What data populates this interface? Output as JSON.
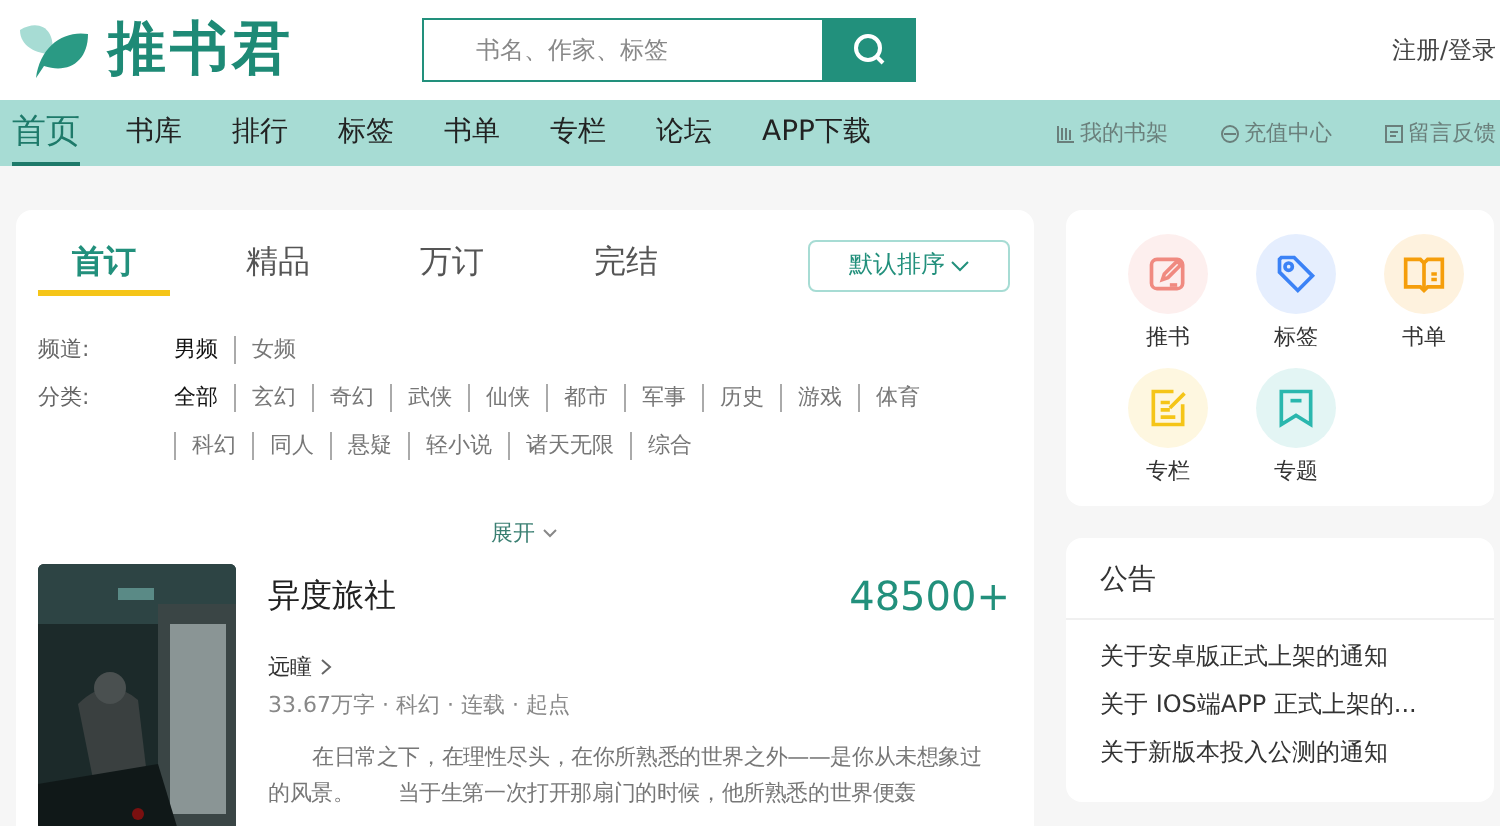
{
  "header": {
    "logo": "推书君",
    "search": {
      "placeholder": "书名、作家、标签"
    },
    "account": "注册/登录"
  },
  "nav": {
    "items": [
      {
        "label": "首页",
        "selected": true
      },
      {
        "label": "书库",
        "selected": false
      },
      {
        "label": "排行",
        "selected": false
      },
      {
        "label": "标签",
        "selected": false
      },
      {
        "label": "书单",
        "selected": false
      },
      {
        "label": "专栏",
        "selected": false
      },
      {
        "label": "论坛",
        "selected": false
      },
      {
        "label": "APP下载",
        "selected": false
      }
    ],
    "links": [
      {
        "label": "我的书架",
        "kind": "shelf"
      },
      {
        "label": "充值中心",
        "kind": "coin"
      },
      {
        "label": "留言反馈",
        "kind": "feedback"
      }
    ]
  },
  "main": {
    "tabs": [
      {
        "label": "首订",
        "selected": true
      },
      {
        "label": "精品",
        "selected": false
      },
      {
        "label": "万订",
        "selected": false
      },
      {
        "label": "完结",
        "selected": false
      }
    ],
    "sort": "默认排序",
    "filters": [
      {
        "label": "频道:",
        "options": [
          {
            "label": "男频",
            "selected": true
          },
          {
            "label": "女频",
            "selected": false
          }
        ]
      },
      {
        "label": "分类:",
        "options": [
          {
            "label": "全部",
            "selected": true
          },
          {
            "label": "玄幻",
            "selected": false
          },
          {
            "label": "奇幻",
            "selected": false
          },
          {
            "label": "武侠",
            "selected": false
          },
          {
            "label": "仙侠",
            "selected": false
          },
          {
            "label": "都市",
            "selected": false
          },
          {
            "label": "军事",
            "selected": false
          },
          {
            "label": "历史",
            "selected": false
          },
          {
            "label": "游戏",
            "selected": false
          },
          {
            "label": "体育",
            "selected": false
          },
          {
            "label": "科幻",
            "selected": false
          },
          {
            "label": "同人",
            "selected": false
          },
          {
            "label": "悬疑",
            "selected": false
          },
          {
            "label": "轻小说",
            "selected": false
          },
          {
            "label": "诸天无限",
            "selected": false
          },
          {
            "label": "综合",
            "selected": false
          }
        ]
      }
    ],
    "expand": "展开",
    "books": [
      {
        "title": "异度旅社",
        "count": "48500+",
        "author": "远瞳",
        "meta": "33.67万字  ·  科幻  ·  连载  ·  起点",
        "description": "在日常之下，在理性尽头，在你所熟悉的世界之外——是你从未想象过的风景。　　当于生第一次打开那扇门的时候，他所熟悉的世界便轰"
      }
    ]
  },
  "shortcuts": [
    {
      "label": "推书",
      "kind": "pen",
      "color": "#f08a80"
    },
    {
      "label": "标签",
      "kind": "tag",
      "color": "#3b82f6"
    },
    {
      "label": "书单",
      "kind": "book",
      "color": "#f59e0b"
    },
    {
      "label": "专栏",
      "kind": "note",
      "color": "#f5c518"
    },
    {
      "label": "专题",
      "kind": "bookmark",
      "color": "#2ab7ae"
    }
  ],
  "notices": {
    "title": "公告",
    "items": [
      "关于安卓版正式上架的通知",
      "关于 IOS端APP 正式上架的...",
      "关于新版本投入公测的通知"
    ]
  }
}
